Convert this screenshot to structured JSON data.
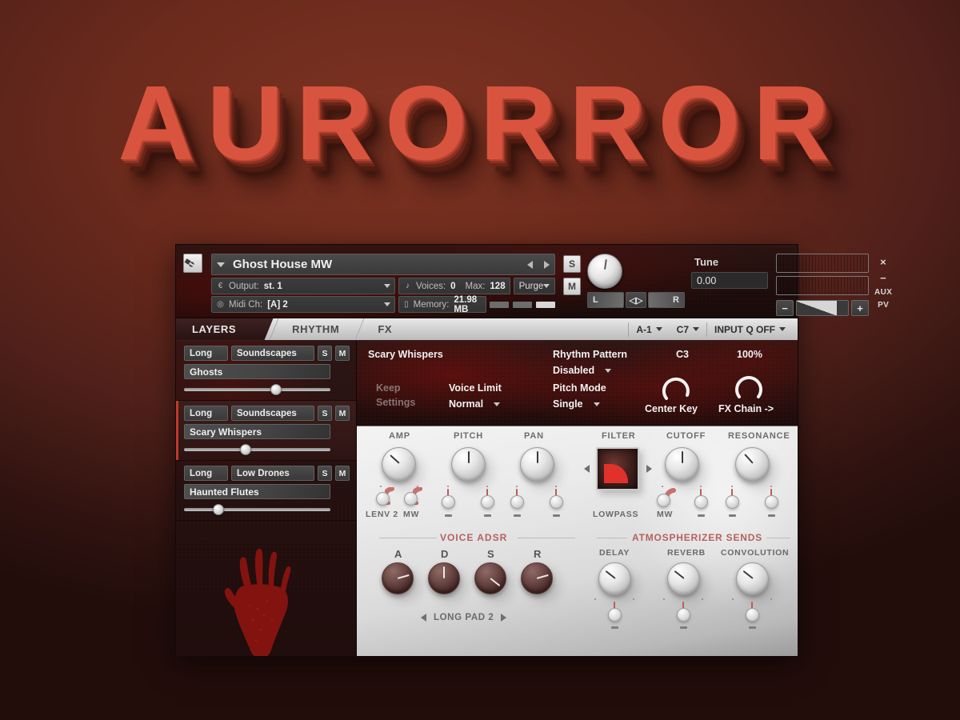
{
  "logo": {
    "text": "AURORROR"
  },
  "header": {
    "wrench_icon": "wrench-icon",
    "instrument_name": "Ghost House MW",
    "output_label": "Output:",
    "output_value": "st. 1",
    "midi_label": "Midi Ch:",
    "midi_value": "[A] 2",
    "voices_label": "Voices:",
    "voices_value": "0",
    "max_label": "Max:",
    "max_value": "128",
    "memory_label": "Memory:",
    "memory_value": "21.98 MB",
    "purge_label": "Purge",
    "solo_label": "S",
    "mute_label": "M",
    "tune_label": "Tune",
    "tune_value": "0.00",
    "pan_left": "L",
    "pan_right": "R",
    "vol_minus": "−",
    "vol_plus": "+",
    "edge_buttons": [
      "×",
      "−",
      "AUX",
      "PV"
    ]
  },
  "tabs": {
    "items": [
      {
        "label": "LAYERS",
        "active": true
      },
      {
        "label": "RHYTHM",
        "active": false
      },
      {
        "label": "FX",
        "active": false
      }
    ],
    "right": [
      {
        "label": "A-1"
      },
      {
        "label": "C7"
      },
      {
        "label": "INPUT Q  OFF"
      }
    ]
  },
  "layers": [
    {
      "length": "Long",
      "category": "Soundscapes",
      "solo": "S",
      "mute": "M",
      "name": "Ghosts",
      "volume_pct": 63,
      "selected": false
    },
    {
      "length": "Long",
      "category": "Soundscapes",
      "solo": "S",
      "mute": "M",
      "name": "Scary Whispers",
      "volume_pct": 42,
      "selected": true
    },
    {
      "length": "Long",
      "category": "Low Drones",
      "solo": "S",
      "mute": "M",
      "name": "Haunted Flutes",
      "volume_pct": 22,
      "selected": false
    }
  ],
  "dark_panel": {
    "layer_title": "Scary Whispers",
    "keep_settings_line1": "Keep",
    "keep_settings_line2": "Settings",
    "voice_limit_label": "Voice Limit",
    "voice_limit_value": "Normal",
    "rhythm_pattern_label": "Rhythm Pattern",
    "rhythm_pattern_value": "Disabled",
    "pitch_mode_label": "Pitch Mode",
    "pitch_mode_value": "Single",
    "center_key_value": "C3",
    "center_key_label": "Center Key",
    "fx_chain_value": "100%",
    "fx_chain_label": "FX Chain ->"
  },
  "controls": {
    "amp": {
      "title": "AMP",
      "knob_deg": -48,
      "mod1_label": "LENV 2",
      "mod2_label": "MW"
    },
    "pitch": {
      "title": "PITCH",
      "knob_deg": 0,
      "mod1_label": "–",
      "mod2_label": "–"
    },
    "pan": {
      "title": "PAN",
      "knob_deg": 0,
      "mod1_label": "–",
      "mod2_label": "–"
    },
    "filter": {
      "title": "FILTER",
      "type_label": "LOWPASS"
    },
    "cutoff": {
      "title": "CUTOFF",
      "knob_deg": 0,
      "mod1_label": "MW",
      "mod2_label": "–"
    },
    "resonance": {
      "title": "RESONANCE",
      "knob_deg": -42,
      "mod1_label": "–",
      "mod2_label": "–"
    }
  },
  "adsr": {
    "title": "VOICE ADSR",
    "knobs": [
      {
        "label": "A",
        "deg": 74
      },
      {
        "label": "D",
        "deg": 0
      },
      {
        "label": "S",
        "deg": 128
      },
      {
        "label": "R",
        "deg": 74
      }
    ],
    "preset_name": "LONG PAD 2"
  },
  "sends": {
    "title": "ATMOSPHERIZER SENDS",
    "knobs": [
      {
        "label": "DELAY",
        "deg": -52,
        "mod_label": "–"
      },
      {
        "label": "REVERB",
        "deg": -52,
        "mod_label": "–"
      },
      {
        "label": "CONVOLUTION",
        "deg": -52,
        "mod_label": "–"
      }
    ]
  },
  "colors": {
    "background": "#6b2a1c",
    "logo_red": "#d9543f",
    "accent_red": "#c0392b",
    "panel_light": "#e9e9e9",
    "panel_dark": "#251110",
    "blood": "#8c1410"
  }
}
